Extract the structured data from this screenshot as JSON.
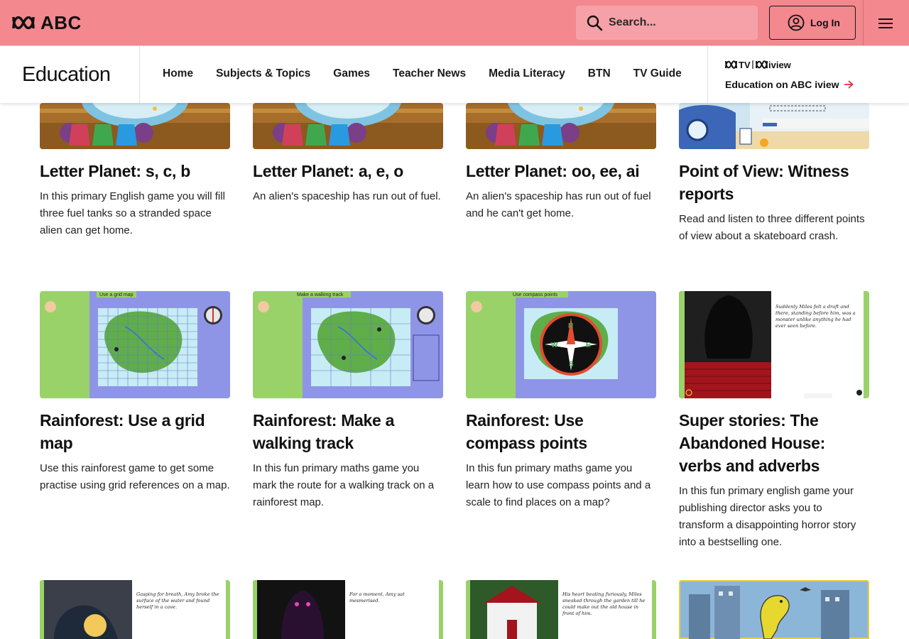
{
  "header": {
    "brand": "ABC",
    "search_placeholder": "Search...",
    "login_label": "Log In",
    "menu_icon": "hamburger-menu-icon",
    "accent_color": "#f3888f"
  },
  "nav": {
    "section_title": "Education",
    "links": [
      "Home",
      "Subjects & Topics",
      "Games",
      "Teacher News",
      "Media Literacy",
      "BTN",
      "TV Guide"
    ],
    "iview_brand": "ABC TV iview",
    "iview_link": "Education on ABC iview"
  },
  "cards_row1": [
    {
      "title": "Letter Planet: s, c, b",
      "description": "In this primary English game you will fill three fuel tanks so a stranded space alien can get home."
    },
    {
      "title": "Letter Planet: a, e, o",
      "description": "An alien's spaceship has run out of fuel."
    },
    {
      "title": "Letter Planet: oo, ee, ai",
      "description": "An alien's spaceship has run out of fuel and he can't get home."
    },
    {
      "title": "Point of View: Witness reports",
      "description": "Read and listen to three different points of view about a skateboard crash."
    }
  ],
  "cards_row2": [
    {
      "title": "Rainforest: Use a grid map",
      "description": "Use this rainforest game to get some practise using grid references on a map.",
      "thumb_heading": "Use a grid map"
    },
    {
      "title": "Rainforest: Make a walking track",
      "description": "In this fun primary maths game you mark the route for a walking track on a rainforest map.",
      "thumb_heading": "Make a walking track"
    },
    {
      "title": "Rainforest: Use compass points",
      "description": "In this fun primary maths game you learn how to use compass points and a scale to find places on a map?",
      "thumb_heading": "Use compass points"
    },
    {
      "title": "Super stories: The Abandoned House: verbs and adverbs",
      "description": "In this fun primary english game your publishing director asks you to transform a disappointing horror story into a bestselling one.",
      "thumb_text": "Suddenly Miles felt a draft and there, standing before him, was a monster unlike anything he had ever seen before."
    }
  ],
  "cards_row3_thumbs": [
    {
      "thumb_text": "Gasping for breath, Amy broke the surface of the water and found herself in a cave."
    },
    {
      "thumb_text": "For a moment, Amy sat mesmerised."
    },
    {
      "thumb_text": "His heart beating furiously, Miles sneaked through the garden till he could make out the old house in front of him."
    },
    {
      "thumb_text": ""
    }
  ]
}
